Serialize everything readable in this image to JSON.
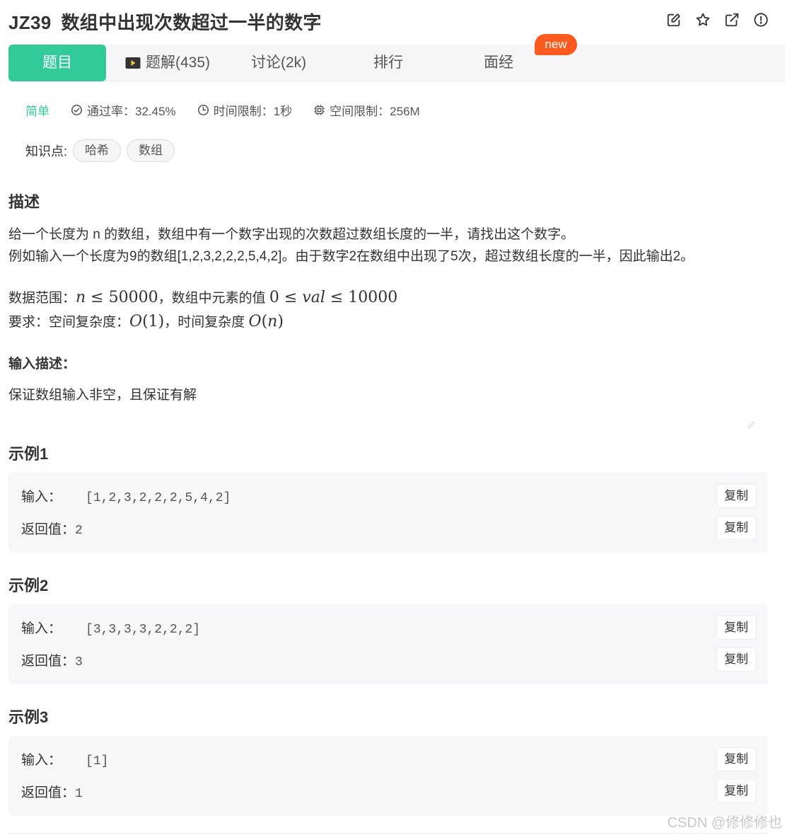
{
  "title": {
    "id": "JZ39",
    "text": "数组中出现次数超过一半的数字"
  },
  "top_icons": [
    "edit-icon",
    "star-icon",
    "share-icon",
    "info-icon"
  ],
  "tabs": [
    {
      "label": "题目"
    },
    {
      "label": "题解(435)",
      "icon": "video-icon"
    },
    {
      "label": "讨论(2k)"
    },
    {
      "label": "排行"
    },
    {
      "label": "面经",
      "badge": "new"
    }
  ],
  "meta": {
    "difficulty": "简单",
    "pass_rate": "通过率：32.45%",
    "time_limit": "时间限制：1秒",
    "space_limit": "空间限制：256M"
  },
  "knowledge": {
    "label": "知识点:",
    "tags": [
      "哈希",
      "数组"
    ]
  },
  "description": {
    "heading": "描述",
    "line1": "给一个长度为 n 的数组，数组中有一个数字出现的次数超过数组长度的一半，请找出这个数字。",
    "line2": "例如输入一个长度为9的数组[1,2,3,2,2,2,5,4,2]。由于数字2在数组中出现了5次，超过数组长度的一半，因此输出2。",
    "range_prefix": "数据范围：",
    "range_mid": "，数组中元素的值 ",
    "req_prefix": "要求：空间复杂度：",
    "req_mid": "，时间复杂度 "
  },
  "input_desc": {
    "heading": "输入描述：",
    "text": "保证数组输入非空，且保证有解"
  },
  "examples": [
    {
      "heading": "示例1",
      "input_label": "输入：",
      "input": "[1,2,3,2,2,2,5,4,2]",
      "output_label": "返回值：",
      "output": "2",
      "copy": "复制"
    },
    {
      "heading": "示例2",
      "input_label": "输入：",
      "input": "[3,3,3,3,2,2,2]",
      "output_label": "返回值：",
      "output": "3",
      "copy": "复制"
    },
    {
      "heading": "示例3",
      "input_label": "输入：",
      "input": "[1]",
      "output_label": "返回值：",
      "output": "1",
      "copy": "复制"
    }
  ],
  "watermark": "CSDN @修修修也",
  "colors": {
    "accent": "#32ca99",
    "badge": "#ff5a1f"
  }
}
